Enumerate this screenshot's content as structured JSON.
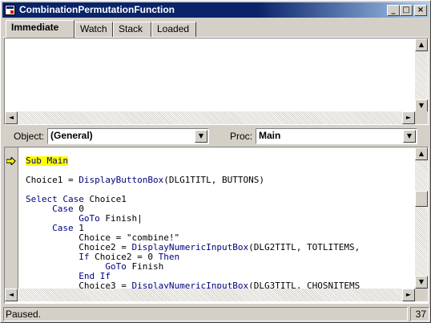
{
  "window": {
    "title": "CombinationPermutationFunction",
    "min_glyph": "_",
    "max_glyph": "□",
    "close_glyph": "×"
  },
  "tabs": [
    {
      "label": "Immediate",
      "active": true
    },
    {
      "label": "Watch",
      "active": false
    },
    {
      "label": "Stack",
      "active": false
    },
    {
      "label": "Loaded",
      "active": false
    }
  ],
  "toolbar": {
    "object_label": "Object:",
    "object_value": "(General)",
    "proc_label": "Proc:",
    "proc_value": "Main"
  },
  "scroll": {
    "up": "▲",
    "down": "▼",
    "left": "◄",
    "right": "►",
    "dropdown": "▼"
  },
  "code": {
    "lines": [
      {
        "indent": "",
        "parts": [
          {
            "t": "Sub Main",
            "c": "kw-hl"
          }
        ]
      },
      {
        "indent": "",
        "parts": []
      },
      {
        "indent": "",
        "parts": [
          {
            "t": "Choice1 = ",
            "c": ""
          },
          {
            "t": "DisplayButtonBox",
            "c": "kw"
          },
          {
            "t": "(DLG1TITL, BUTTONS)",
            "c": ""
          }
        ]
      },
      {
        "indent": "",
        "parts": []
      },
      {
        "indent": "",
        "parts": [
          {
            "t": "Select Case",
            "c": "kw"
          },
          {
            "t": " Choice1",
            "c": ""
          }
        ]
      },
      {
        "indent": "     ",
        "parts": [
          {
            "t": "Case",
            "c": "kw"
          },
          {
            "t": " 0",
            "c": ""
          }
        ]
      },
      {
        "indent": "          ",
        "parts": [
          {
            "t": "GoTo",
            "c": "kw"
          },
          {
            "t": " Finish|",
            "c": ""
          }
        ]
      },
      {
        "indent": "     ",
        "parts": [
          {
            "t": "Case",
            "c": "kw"
          },
          {
            "t": " 1",
            "c": ""
          }
        ]
      },
      {
        "indent": "          ",
        "parts": [
          {
            "t": "Choice = \"combine!\"",
            "c": ""
          }
        ]
      },
      {
        "indent": "          ",
        "parts": [
          {
            "t": "Choice2 = ",
            "c": ""
          },
          {
            "t": "DisplayNumericInputBox",
            "c": "kw"
          },
          {
            "t": "(DLG2TITL, TOTLITEMS,",
            "c": ""
          }
        ]
      },
      {
        "indent": "          ",
        "parts": [
          {
            "t": "If",
            "c": "kw"
          },
          {
            "t": " Choice2 = 0 ",
            "c": ""
          },
          {
            "t": "Then",
            "c": "kw"
          }
        ]
      },
      {
        "indent": "               ",
        "parts": [
          {
            "t": "GoTo",
            "c": "kw"
          },
          {
            "t": " Finish",
            "c": ""
          }
        ]
      },
      {
        "indent": "          ",
        "parts": [
          {
            "t": "End If",
            "c": "kw"
          }
        ]
      },
      {
        "indent": "          ",
        "parts": [
          {
            "t": "Choice3 = ",
            "c": ""
          },
          {
            "t": "DisplayNumericInputBox",
            "c": "kw"
          },
          {
            "t": "(DLG3TITL, CHOSNITEMS",
            "c": ""
          }
        ]
      }
    ]
  },
  "status": {
    "text": "Paused.",
    "line_number": "37"
  },
  "colors": {
    "keyword": "#00007f",
    "highlight": "#ffff00",
    "titlebar": "#0a246a"
  }
}
